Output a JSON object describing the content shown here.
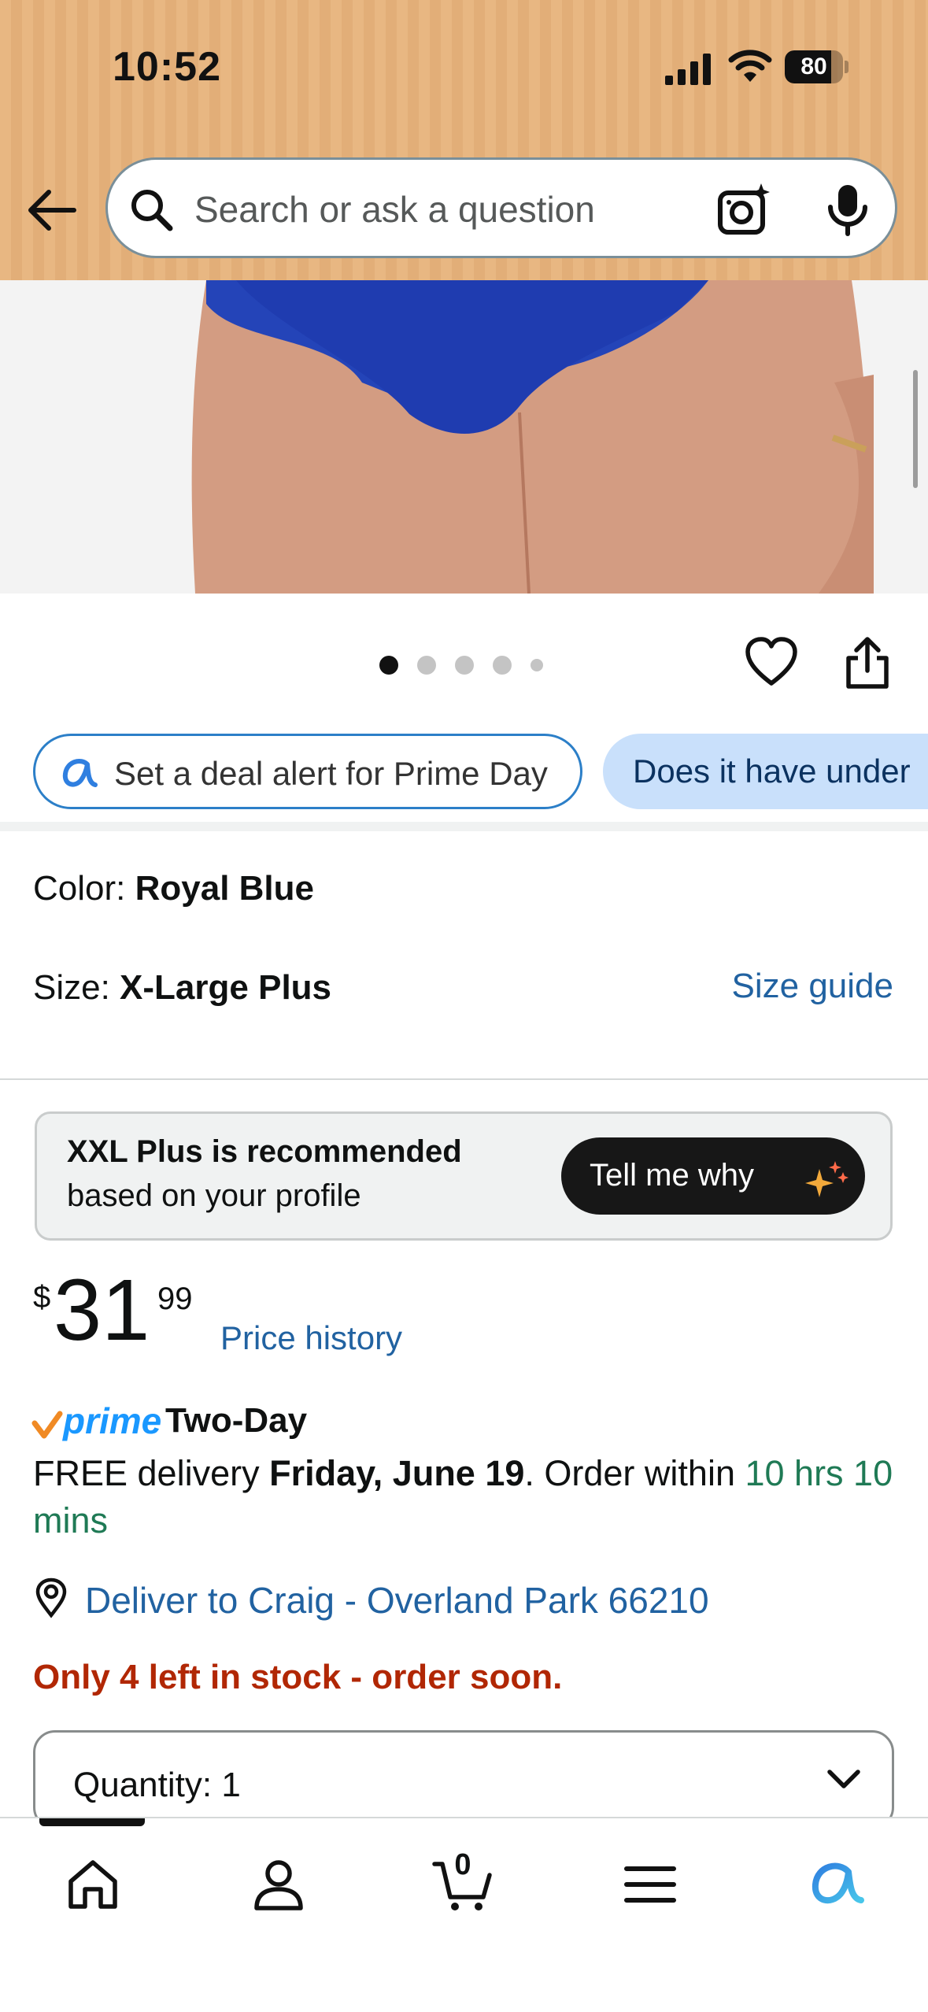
{
  "status_bar": {
    "time": "10:52",
    "battery": "80"
  },
  "search": {
    "placeholder": "Search or ask a question"
  },
  "gallery": {
    "dots": 5,
    "active_index": 0
  },
  "chips": {
    "deal_alert": "Set a deal alert for Prime Day",
    "question": "Does it have under"
  },
  "variation": {
    "color_label": "Color: ",
    "color_value": "Royal Blue",
    "size_label": "Size: ",
    "size_value": "X-Large Plus",
    "size_guide": "Size guide"
  },
  "recommendation": {
    "title": "XXL Plus is recommended",
    "subtitle": "based on your profile",
    "button": "Tell me why"
  },
  "price": {
    "symbol": "$",
    "whole": "31",
    "fraction": "99",
    "history_link": "Price history"
  },
  "delivery": {
    "prime_word": "prime",
    "prime_speed": "Two-Day",
    "free_prefix": "FREE delivery ",
    "date": "Friday, June 19",
    "order_within": ". Order within ",
    "countdown": "10 hrs 10 mins",
    "deliver_to": "Deliver to Craig - Overland Park 66210",
    "stock": "Only 4 left in stock - order soon."
  },
  "quantity": {
    "label": "Quantity:",
    "value": "1"
  },
  "bottom_nav": {
    "cart_count": "0"
  },
  "colors": {
    "header": "#e8b782",
    "link": "#2162a1",
    "stock_red": "#b12704",
    "countdown_green": "#1f7a55",
    "chip_blue": "#c9e0fb",
    "prime_blue": "#1a98ff"
  },
  "icons": [
    "back-arrow-icon",
    "search-icon",
    "camera-icon",
    "mic-icon",
    "heart-icon",
    "share-icon",
    "rufus-icon",
    "sparkle-icon",
    "location-icon",
    "chevron-down-icon",
    "home-icon",
    "account-icon",
    "cart-icon",
    "menu-icon"
  ]
}
